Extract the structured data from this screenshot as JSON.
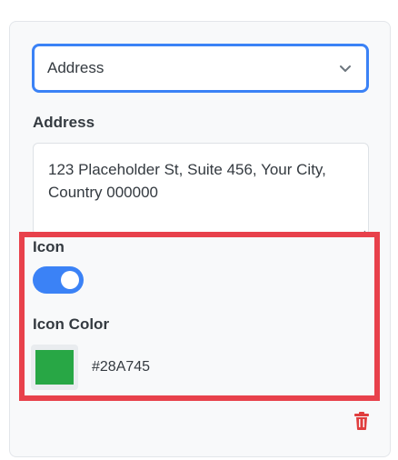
{
  "select": {
    "value": "Address"
  },
  "address": {
    "label": "Address",
    "value": "123 Placeholder St, Suite 456, Your City, Country 000000"
  },
  "icon": {
    "label": "Icon",
    "enabled": true
  },
  "icon_color": {
    "label": "Icon Color",
    "value": "#28A745"
  },
  "colors": {
    "accent": "#3b82f6",
    "highlight": "#e8414b",
    "danger": "#e03e3e"
  },
  "icons": {
    "dropdown": "chevron-down-icon",
    "delete": "trash-icon"
  }
}
